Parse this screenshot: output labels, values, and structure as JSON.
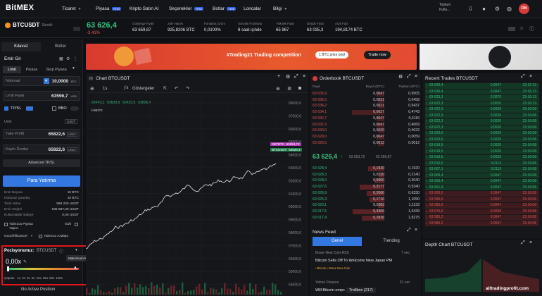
{
  "nav": {
    "logo": "BitMEX",
    "items": [
      {
        "label": "Ticaret",
        "chevron": true,
        "badge": ""
      },
      {
        "label": "Piyasa",
        "chevron": false,
        "badge": "YENİ"
      },
      {
        "label": "Kripto Satın Al",
        "chevron": false,
        "badge": ""
      },
      {
        "label": "Seçenekler",
        "chevron": false,
        "badge": "YENİ"
      },
      {
        "label": "Botlar",
        "chevron": false,
        "badge": "YENİ"
      },
      {
        "label": "Loncalar",
        "chevron": false,
        "badge": ""
      },
      {
        "label": "Bilgi",
        "chevron": true,
        "badge": ""
      }
    ],
    "balance_label": "Toplam",
    "balance_sub": "Kulla...",
    "avatar": "ON"
  },
  "ticker": {
    "symbol": "BTCUSDT",
    "symbol_sub": "Sürekli",
    "price": "63 626,4",
    "change": "-3,41%",
    "stats": [
      {
        "label": "Gösterge Fiyatı",
        "value": "63 659,87"
      },
      {
        "label": "24H Hacim",
        "value": "925,8206 BTC"
      },
      {
        "label": "Fonlama Oranı",
        "value": "0,0100%"
      },
      {
        "label": "Sonraki Fonlama",
        "value": "8 saat içinde"
      },
      {
        "label": "Yüksek Fiyat",
        "value": "65 967"
      },
      {
        "label": "Düşük Fiyat",
        "value": "63 035,3"
      },
      {
        "label": "Açık Faiz",
        "value": "194,8174 BTC"
      }
    ]
  },
  "order_panel": {
    "tabs": [
      "Kılavuz",
      "Botlar"
    ],
    "title": "Emir Gir",
    "type_tabs": [
      "Limit",
      "Piyasa",
      "Stop Piyasa"
    ],
    "notional_label": "Notional",
    "notional_value": "10,0000",
    "notional_unit": "BTC",
    "limit_label": "Limit Fiyatı",
    "limit_value": "63596,7",
    "limit_unit": "USD",
    "tpsl_label": "TP/SL",
    "bbo_label": "BBO",
    "unit_label": "Unit:",
    "unit_value": "USDT",
    "tp_label": "Take Profit",
    "tp_value": "65822,6",
    "tp_unit": "USDT",
    "sl_label": "Kaybı Durdur",
    "sl_value": "65822,6",
    "sl_unit": "USDT",
    "advanced": "Advanced TP/SL",
    "buy_button": "Para Yatırma",
    "summary": [
      {
        "k": "Emir Boyutu",
        "v": "10 BTC"
      },
      {
        "k": "Notional Quantity",
        "v": "10 BTC"
      },
      {
        "k": "Total Value",
        "v": "858 226 USDT"
      },
      {
        "k": "Emir Değeri",
        "v": "635 987,00 USDT"
      },
      {
        "k": "Kullanılabilir Bakiye",
        "v": "0,00 USDT"
      }
    ],
    "post_only": "Yalnızca Piyasa Yapıcı",
    "hidden": "Gizli",
    "tif": "GoodTillCancel",
    "reduce_only": "Yalnızca Azaltan"
  },
  "position": {
    "title": "Pozisyonunuz:",
    "symbol": "BTCUSDT",
    "leverage": "0,00x",
    "tooltip": "Maksimum Kaldıraç: 200x",
    "cross_label": "Çapraz",
    "levels": [
      "1x",
      "2x",
      "3x",
      "5x",
      "10x",
      "25x",
      "50x",
      "100x"
    ],
    "no_position": "No Active Position"
  },
  "banner": {
    "headline": "#Trading21 Trading competition",
    "prize": "1 BTC prize pool",
    "cta": "Trade now"
  },
  "chart_panel": {
    "title": "Chart BTCUSDT",
    "interval": "1s",
    "indicators": "Göstergeler",
    "ohlc": [
      "63449,2",
      "63629,9",
      "63423,9",
      "63626,4"
    ],
    "volume_label": "Hacim",
    "price_ticks": [
      "68000,0",
      "67000,0",
      "66000,0",
      "65000,0",
      "64000,0",
      "63000,0",
      "62000,0",
      "61000,0",
      "60000,0",
      "59000,0",
      "58000,0",
      "57000,0",
      "56000,0",
      "55000,0",
      "54000,0"
    ],
    "xbt_tag": "XBTBTC",
    "xbt_price": "63653,72",
    "btc_tag": "BTCUSDT",
    "btc_price": "63626,4"
  },
  "orderbook": {
    "title": "Orderbook BTCUSDT",
    "headers": [
      "Fiyat",
      "Boyut (BTC)",
      "Toplam (BTC)"
    ],
    "asks": [
      [
        "63 635,9",
        "0,0047",
        "0,9505"
      ],
      [
        "63 635,0",
        "0,0021",
        "0,9458"
      ],
      [
        "63 634,2",
        "0,0021",
        "0,9437"
      ],
      [
        "63 634,1",
        "0,0627",
        "0,4743"
      ],
      [
        "63 632,7",
        "0,0047",
        "0,4116"
      ],
      [
        "63 631,5",
        "0,0047",
        "0,4069"
      ],
      [
        "63 630,0",
        "0,0020",
        "0,4022"
      ],
      [
        "63 629,0",
        "0,0047",
        "0,0059"
      ],
      [
        "63 626,5",
        "0,0012",
        "0,0012"
      ]
    ],
    "mid_price": "63 626,4",
    "mid_index": "63 653,72",
    "mid_mark": "63 659,87",
    "bids": [
      [
        "63 628,4",
        "0,1920",
        "0,1920"
      ],
      [
        "63 628,3",
        "0,0220",
        "0,2140"
      ],
      [
        "63 628,0",
        "0,0900",
        "0,3040"
      ],
      [
        "63 627,6",
        "0,3177",
        "0,5340"
      ],
      [
        "63 626,9",
        "0,2060",
        "0,6330"
      ],
      [
        "63 626,3",
        "0,1710",
        "1,1050"
      ],
      [
        "63 623,1",
        "0,0283",
        "1,1133"
      ],
      [
        "63 617,5",
        "0,4306",
        "1,5439"
      ],
      [
        "63 617,4",
        "0,2836",
        "1,8275"
      ]
    ]
  },
  "trades": {
    "title": "Recent Trades BTCUSDT",
    "rows": [
      [
        "63 626,4",
        "0,0047",
        "23:16:13"
      ],
      [
        "63 626,4",
        "0,0047",
        "23:16:13"
      ],
      [
        "63 623,3",
        "0,0070",
        "23:16:13"
      ],
      [
        "63 622,3",
        "0,0020",
        "23:16:13"
      ],
      [
        "63 622,3",
        "0,0020",
        "23:16:08"
      ],
      [
        "63 622,3",
        "0,0020",
        "23:16:08"
      ],
      [
        "63 622,3",
        "0,0020",
        "23:16:08"
      ],
      [
        "63 622,3",
        "0,0020",
        "23:16:08"
      ],
      [
        "63 620,0",
        "0,0020",
        "23:16:08"
      ],
      [
        "63 620,0",
        "0,0020",
        "23:16:08"
      ],
      [
        "63 619,5",
        "0,0020",
        "23:16:08"
      ],
      [
        "63 619,5",
        "0,0020",
        "23:16:08"
      ],
      [
        "63 619,5",
        "0,0020",
        "23:16:08"
      ],
      [
        "63 610,0",
        "0,0113",
        "23:16:08"
      ],
      [
        "63 607,1",
        "0,0113",
        "23:16:08"
      ],
      [
        "63 606,4",
        "0,0047",
        "23:16:08"
      ],
      [
        "63 606,4",
        "0,0047",
        "23:16:08"
      ],
      [
        "63 601,3",
        "0,0047",
        "23:16:08"
      ],
      [
        "63 600,0",
        "0,0047",
        "23:16:08"
      ],
      [
        "63 590,0",
        "0,0047",
        "23:16:08"
      ],
      [
        "63 585,0",
        "0,0047",
        "23:16:08"
      ],
      [
        "63 576,0",
        "0,0030",
        "23:16:08"
      ],
      [
        "63 585,2",
        "0,0047",
        "23:16:08"
      ],
      [
        "63 585,2",
        "0,0047",
        "23:16:08"
      ]
    ]
  },
  "news": {
    "title": "News Feed",
    "tabs": [
      "Genel",
      "Trending"
    ],
    "items": [
      {
        "source": "Brave New Coin RSS",
        "time": "7 sec",
        "headline": "Bitcoin Sells Off To Welcome New Japan PM",
        "tags": "• Bitcoin  • Brave New Coin"
      },
      {
        "source": "Yahoo Finance",
        "time": "51 sec",
        "headline": "Will Bitcoin empc",
        "tags": ""
      }
    ],
    "trollbox": "Trollbox (217)"
  },
  "depth": {
    "title": "Depth Chart BTCUSDT"
  },
  "watermark": "alltradingprofit.com",
  "colors": {
    "up": "#32c47b",
    "down": "#e05858",
    "accent": "#3377e0",
    "highlight_frame": "#e0161b"
  }
}
